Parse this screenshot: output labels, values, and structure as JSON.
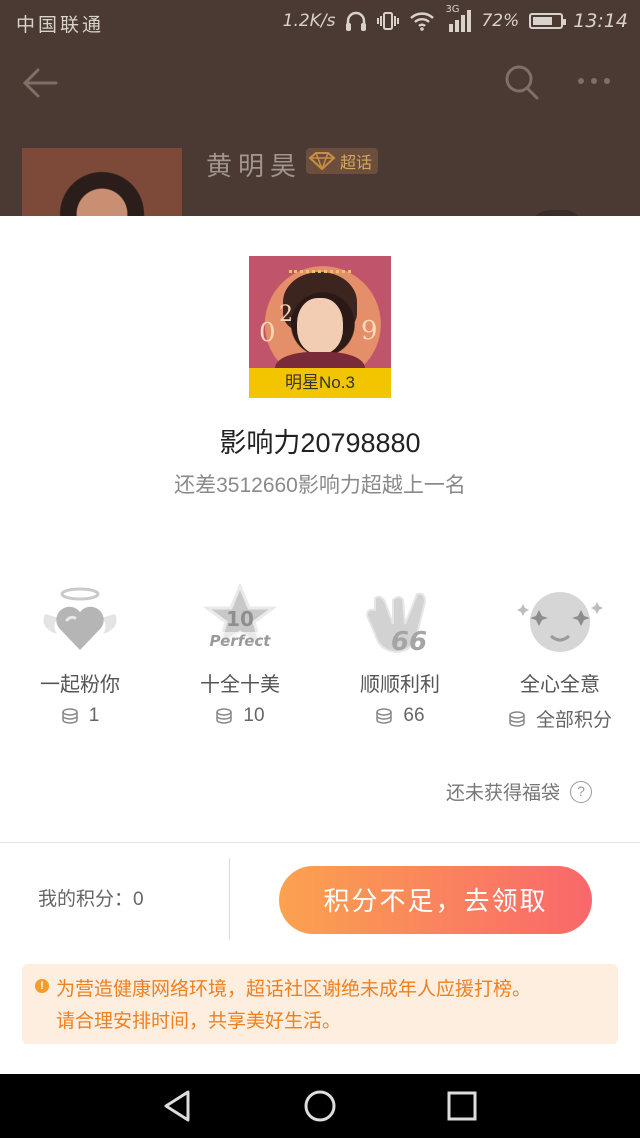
{
  "status_bar": {
    "carrier": "中国联通",
    "net_speed": "1.2K/s",
    "network_type": "3G",
    "battery": "72%",
    "battery_level": 0.72,
    "time": "13:14"
  },
  "background_page": {
    "title": "黄明昊",
    "badge": "超话"
  },
  "rank": {
    "ribbon": "明星No.3",
    "influence": "影响力20798880",
    "gap": "还差3512660影响力超越上一名"
  },
  "gifts": [
    {
      "name": "一起粉你",
      "cost": "1",
      "icon": "heart-wings-icon"
    },
    {
      "name": "十全十美",
      "cost": "10",
      "icon": "perfect-star-icon"
    },
    {
      "name": "顺顺利利",
      "cost": "66",
      "icon": "hand-66-icon"
    },
    {
      "name": "全心全意",
      "cost": "全部积分",
      "icon": "sparkle-face-icon"
    }
  ],
  "fudai_text": "还未获得福袋",
  "points_label": "我的积分：0",
  "claim_button": "积分不足，去领取",
  "notice": {
    "line1": "为营造健康网络环境，超话社区谢绝未成年人应援打榜。",
    "line2": "请合理安排时间，共享美好生活。"
  },
  "colors": {
    "accent_start": "#fba24f",
    "accent_end": "#f9676b",
    "notice_bg": "#fdeedf",
    "notice_text": "#f0801f",
    "ribbon": "#f2c500"
  }
}
